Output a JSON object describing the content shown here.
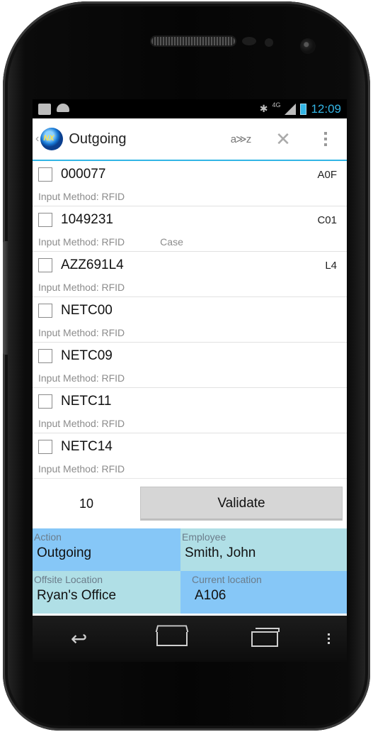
{
  "status_bar": {
    "time": "12:09",
    "network": "4G",
    "icons": [
      "bag-icon",
      "android-icon",
      "bluetooth-icon",
      "signal-icon",
      "battery-icon"
    ]
  },
  "action_bar": {
    "title": "Outgoing",
    "sort_label": "a≫z",
    "icons": [
      "up-caret-icon",
      "app-logo-icon",
      "sort-az-icon",
      "close-icon",
      "overflow-menu-icon"
    ]
  },
  "items": [
    {
      "code": "000077",
      "location": "A0F",
      "method": "Input Method: RFID",
      "kind": ""
    },
    {
      "code": "1049231",
      "location": "C01",
      "method": "Input Method: RFID",
      "kind": "Case"
    },
    {
      "code": "AZZ691L4",
      "location": "L4",
      "method": "Input Method: RFID",
      "kind": ""
    },
    {
      "code": "NETC00",
      "location": "",
      "method": "Input Method: RFID",
      "kind": ""
    },
    {
      "code": "NETC09",
      "location": "",
      "method": "Input Method: RFID",
      "kind": ""
    },
    {
      "code": "NETC11",
      "location": "",
      "method": "Input Method: RFID",
      "kind": ""
    },
    {
      "code": "NETC14",
      "location": "",
      "method": "Input Method: RFID",
      "kind": ""
    }
  ],
  "footer": {
    "count": "10",
    "validate_label": "Validate"
  },
  "info": {
    "action_label": "Action",
    "action_value": "Outgoing",
    "employee_label": "Employee",
    "employee_value": "Smith, John",
    "offsite_label": "Offsite Location",
    "offsite_value": "Ryan's Office",
    "current_label": "Current location",
    "current_value": "A106"
  },
  "colors": {
    "accent": "#33b5e5",
    "info_blue": "#86c7f7",
    "info_teal": "#b0dfe6"
  }
}
